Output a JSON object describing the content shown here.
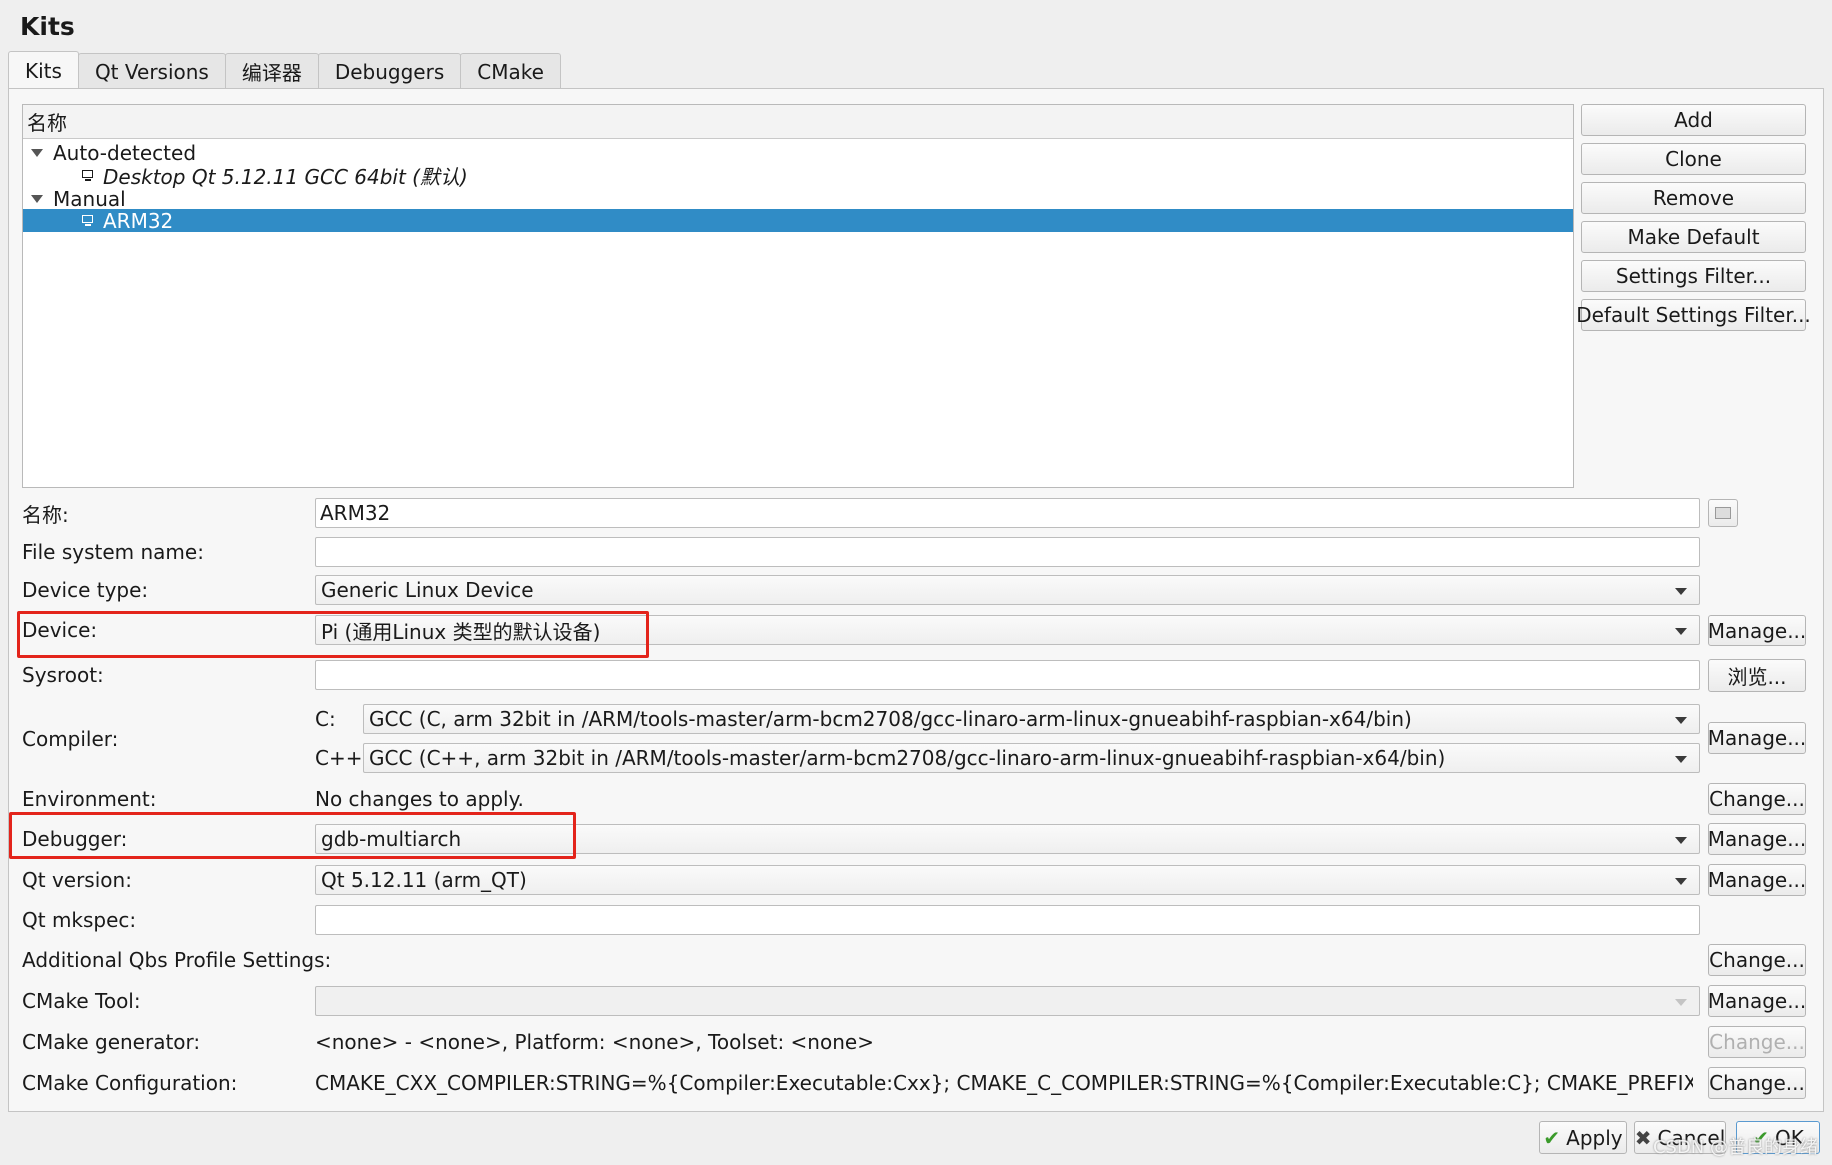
{
  "page": {
    "title": "Kits",
    "tabs": [
      "Kits",
      "Qt Versions",
      "编译器",
      "Debuggers",
      "CMake"
    ],
    "tab_active": 0
  },
  "tree": {
    "header": "名称",
    "groups": [
      {
        "label": "Auto-detected",
        "items": [
          {
            "label": "Desktop Qt 5.12.11 GCC 64bit (默认)",
            "italic": true
          }
        ]
      },
      {
        "label": "Manual",
        "items": [
          {
            "label": "ARM32",
            "selected": true
          }
        ]
      }
    ]
  },
  "side_buttons": [
    "Add",
    "Clone",
    "Remove",
    "Make Default",
    "Settings Filter...",
    "Default Settings Filter..."
  ],
  "form": {
    "name": {
      "label": "名称:",
      "value": "ARM32"
    },
    "fs_name": {
      "label": "File system name:",
      "value": ""
    },
    "device_type": {
      "label": "Device type:",
      "value": "Generic Linux Device"
    },
    "device": {
      "label": "Device:",
      "value": "Pi (通用Linux 类型的默认设备)",
      "button": "Manage..."
    },
    "sysroot": {
      "label": "Sysroot:",
      "value": "",
      "button": "浏览..."
    },
    "compiler": {
      "label": "Compiler:",
      "c_label": "C:",
      "c_value": "GCC (C, arm 32bit in /ARM/tools-master/arm-bcm2708/gcc-linaro-arm-linux-gnueabihf-raspbian-x64/bin)",
      "cpp_label": "C++:",
      "cpp_value": "GCC (C++, arm 32bit in /ARM/tools-master/arm-bcm2708/gcc-linaro-arm-linux-gnueabihf-raspbian-x64/bin)",
      "button": "Manage..."
    },
    "environment": {
      "label": "Environment:",
      "value": "No changes to apply.",
      "button": "Change..."
    },
    "debugger": {
      "label": "Debugger:",
      "value": "gdb-multiarch",
      "button": "Manage..."
    },
    "qt_version": {
      "label": "Qt version:",
      "value": "Qt 5.12.11 (arm_QT)",
      "button": "Manage..."
    },
    "qt_mkspec": {
      "label": "Qt mkspec:",
      "value": ""
    },
    "qbs": {
      "label": "Additional Qbs Profile Settings:",
      "button": "Change..."
    },
    "cmake_tool": {
      "label": "CMake Tool:",
      "value": "",
      "button": "Manage..."
    },
    "cmake_generator": {
      "label": "CMake generator:",
      "value": "<none> - <none>, Platform: <none>, Toolset: <none>",
      "button": "Change..."
    },
    "cmake_config": {
      "label": "CMake Configuration:",
      "value": "CMAKE_CXX_COMPILER:STRING=%{Compiler:Executable:Cxx}; CMAKE_C_COMPILER:STRING=%{Compiler:Executable:C}; CMAKE_PREFIX_PATH:STRIN...",
      "button": "Change..."
    }
  },
  "footer": {
    "apply": "Apply",
    "cancel": "Cancel",
    "ok": "OK"
  },
  "watermark": "CSDN @普良的身绪",
  "colors": {
    "selection": "#308cc6",
    "highlight_box": "#e3241b"
  }
}
